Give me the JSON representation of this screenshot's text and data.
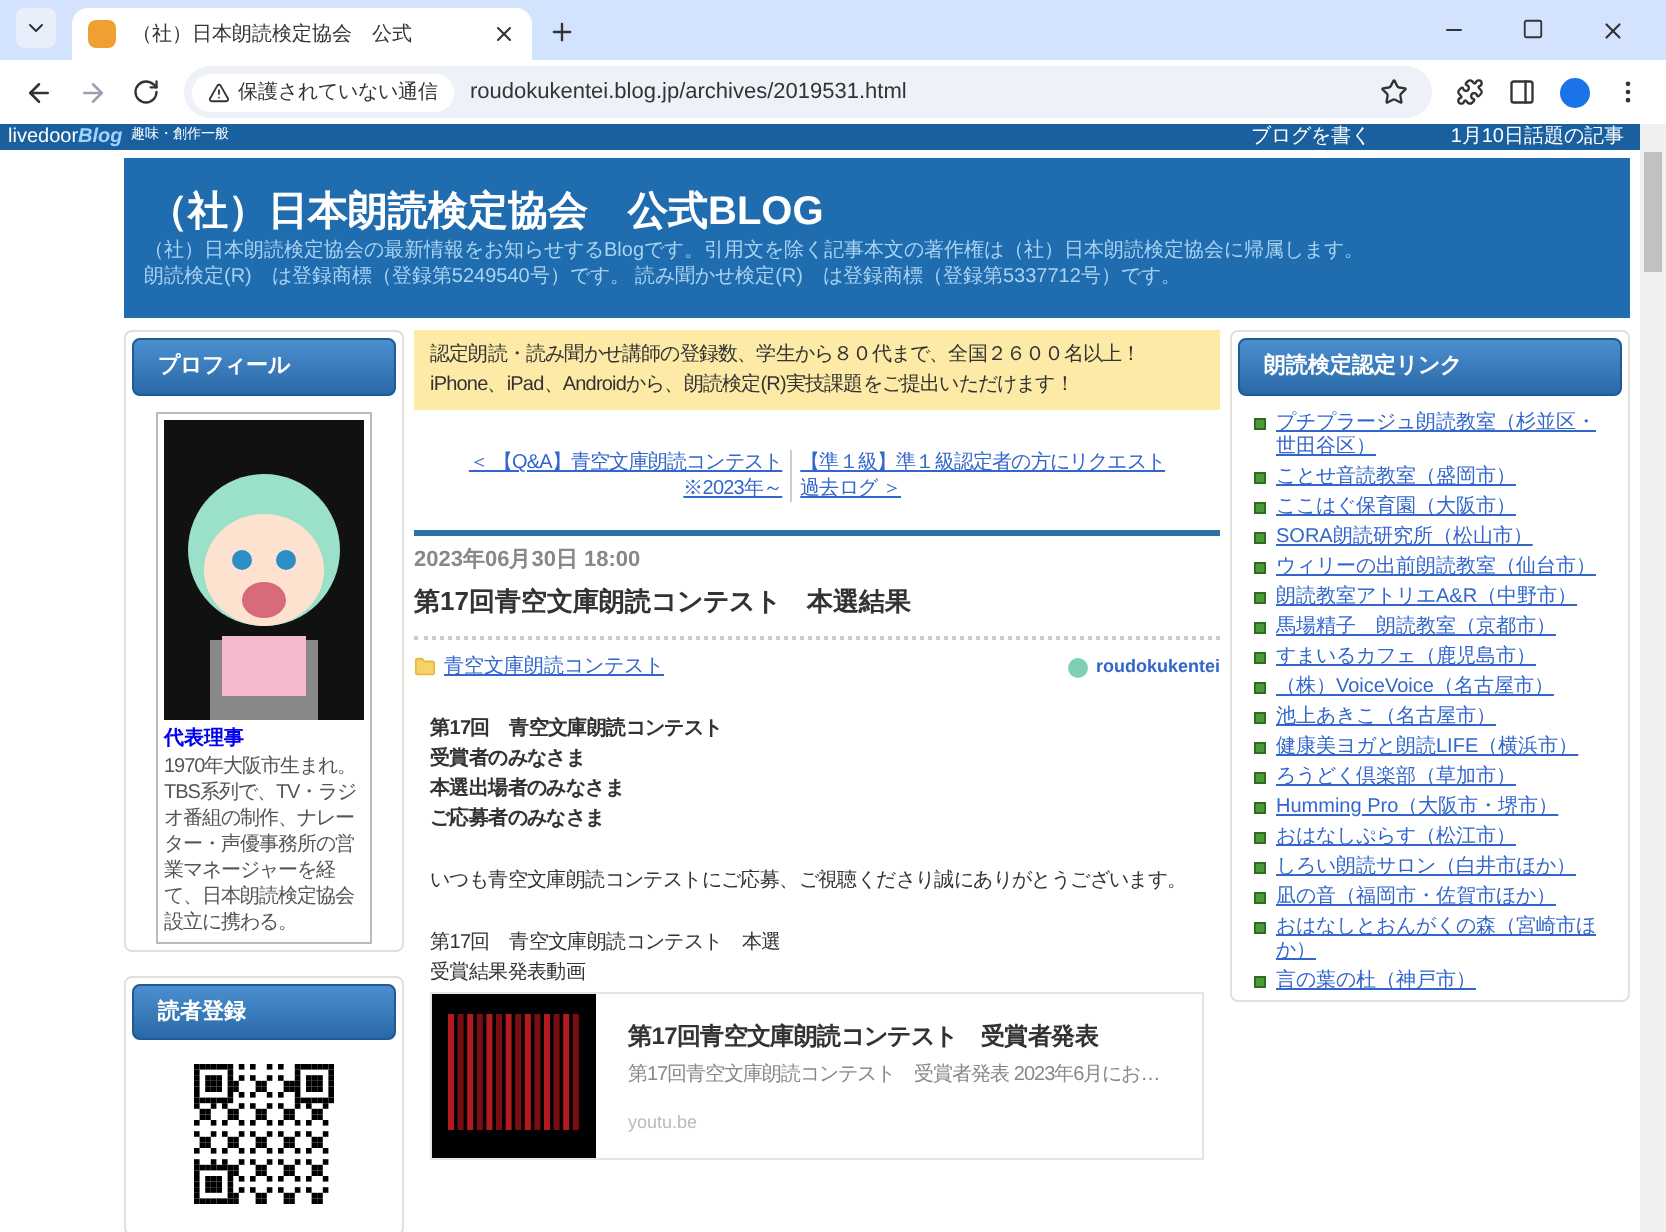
{
  "browser": {
    "tab_title": "（社）日本朗読検定協会　公式",
    "url": "roudokukentei.blog.jp/archives/2019531.html",
    "security_label": "保護されていない通信"
  },
  "blog_bar": {
    "brand": "livedoor",
    "brand_accent": "Blog",
    "category": "趣味・創作一般",
    "links": [
      "ブログを書く",
      "1月10日話題の記事"
    ]
  },
  "header": {
    "title": "（社）日本朗読検定協会　公式BLOG",
    "description": [
      "（社）日本朗読検定協会の最新情報をお知らせするBlogです。引用文を除く記事本文の著作権は（社）日本朗読検定協会に帰属します。",
      "朗読検定(R)　は登録商標（登録第5249540号）です。 読み聞かせ検定(R)　は登録商標（登録第5337712号）です。"
    ]
  },
  "left_sidebar": {
    "profile": {
      "heading": "プロフィール",
      "name": "代表理事",
      "bio": "1970年大阪市生まれ。TBS系列で、TV・ラジオ番組の制作、ナレーター・声優事務所の営業マネージャーを経て、日本朗読検定協会設立に携わる。"
    },
    "reader": {
      "heading": "読者登録"
    }
  },
  "notice": [
    "認定朗読・読み聞かせ講師の登録数、学生から８０代まで、全国２６００名以上！",
    "iPhone、iPad、Androidから、朗読検定(R)実技課題をご提出いただけます！"
  ],
  "pager": {
    "prev": [
      "＜ 【Q&A】青空文庫朗読コンテスト",
      "※2023年～"
    ],
    "next": [
      "【準１級】準１級認定者の方にリクエスト",
      "過去ログ ＞"
    ]
  },
  "post": {
    "date": "2023年06月30日 18:00",
    "title": "第17回青空文庫朗読コンテスト　本選結果",
    "category": "青空文庫朗読コンテスト",
    "author": "roudokukentei",
    "body": [
      {
        "kind": "bold",
        "lines": [
          "第17回　青空文庫朗読コンテスト",
          "受賞者のみなさま",
          "本選出場者のみなさま",
          "ご応募者のみなさま"
        ]
      },
      {
        "kind": "plain",
        "lines": [
          "いつも青空文庫朗読コンテストにご応募、ご視聴くださり誠にありがとうございます。"
        ]
      },
      {
        "kind": "plain",
        "lines": [
          "第17回　青空文庫朗読コンテスト　本選",
          "受賞結果発表動画"
        ]
      }
    ],
    "embed": {
      "title": "第17回青空文庫朗読コンテスト　受賞者発表",
      "description": "第17回青空文庫朗読コンテスト　受賞者発表 2023年6月にお…",
      "domain": "youtu.be"
    }
  },
  "right_sidebar": {
    "heading": "朗読検定認定リンク",
    "links": [
      "プチプラージュ朗読教室（杉並区・世田谷区）",
      "ことせ音読教室（盛岡市）",
      "ここはぐ保育園（大阪市）",
      "SORA朗読研究所（松山市）",
      "ウィリーの出前朗読教室（仙台市）",
      "朗読教室アトリエA&R（中野市）",
      "馬場精子　朗読教室（京都市）",
      "すまいるカフェ（鹿児島市）",
      "（株）VoiceVoice（名古屋市）",
      "池上あきこ（名古屋市）",
      "健康美ヨガと朗読LIFE（横浜市）",
      "ろうどく倶楽部（草加市）",
      "Humming Pro（大阪市・堺市）",
      "おはなしぷらす（松江市）",
      "しろい朗読サロン（白井市ほか）",
      "凪の音（福岡市・佐賀市ほか）",
      "おはなしとおんがくの森（宮崎市ほか）",
      "言の葉の杜（神戸市）"
    ]
  }
}
